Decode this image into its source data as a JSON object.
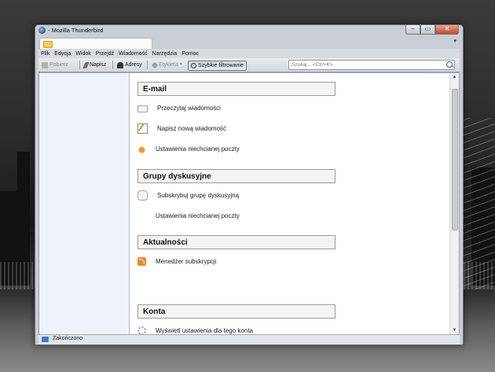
{
  "window": {
    "title": "- Mozilla Thunderbird"
  },
  "window_buttons": {
    "minimize": "–",
    "maximize": "▭",
    "close": "✕"
  },
  "tab": {
    "menu_arrow": "▾"
  },
  "menu": [
    "Plik",
    "Edycja",
    "Widok",
    "Przejdź",
    "Wiadomość",
    "Narzędzia",
    "Pomoc"
  ],
  "toolbar": {
    "get_mail": "Pobierz",
    "write": "Napisz",
    "address_book": "Adresy",
    "tag": "Etykieta",
    "tag_arrow": "▾",
    "quick_filter": "Szybkie filtrowanie",
    "search_placeholder": "Szukaj... <Ctrl+K>"
  },
  "scrollbar": {
    "up": "▲",
    "down": "▼"
  },
  "sections": {
    "email": {
      "title": "E-mail",
      "actions": [
        "Przeczytaj wiadomości",
        "Napisz nową wiadomość",
        "Ustawienia niechcianej poczty"
      ]
    },
    "newsgroups": {
      "title": "Grupy dyskusyjne",
      "actions": [
        "Subskrybuj grupę dyskusyjną",
        "Ustawienia niechcianej poczty"
      ]
    },
    "feeds": {
      "title": "Aktualności",
      "actions": [
        "Menedżer subskrypcji"
      ]
    },
    "accounts": {
      "title": "Konta",
      "actions": [
        "Wyświetl ustawienia dla tego konta"
      ]
    }
  },
  "statusbar": {
    "text": "Zakończono"
  },
  "icons": {
    "app": "thunderbird-icon",
    "folder": "folder-icon",
    "get_mail": "download-icon",
    "write": "pencil-icon",
    "address_book": "contacts-icon",
    "tag": "tag-icon",
    "search": "search-icon",
    "read": "envelope-icon",
    "compose": "compose-icon",
    "junk": "flame-icon",
    "newsgroup": "speech-bubble-icon",
    "rss": "rss-icon",
    "settings": "gear-icon",
    "status": "online-icon"
  }
}
